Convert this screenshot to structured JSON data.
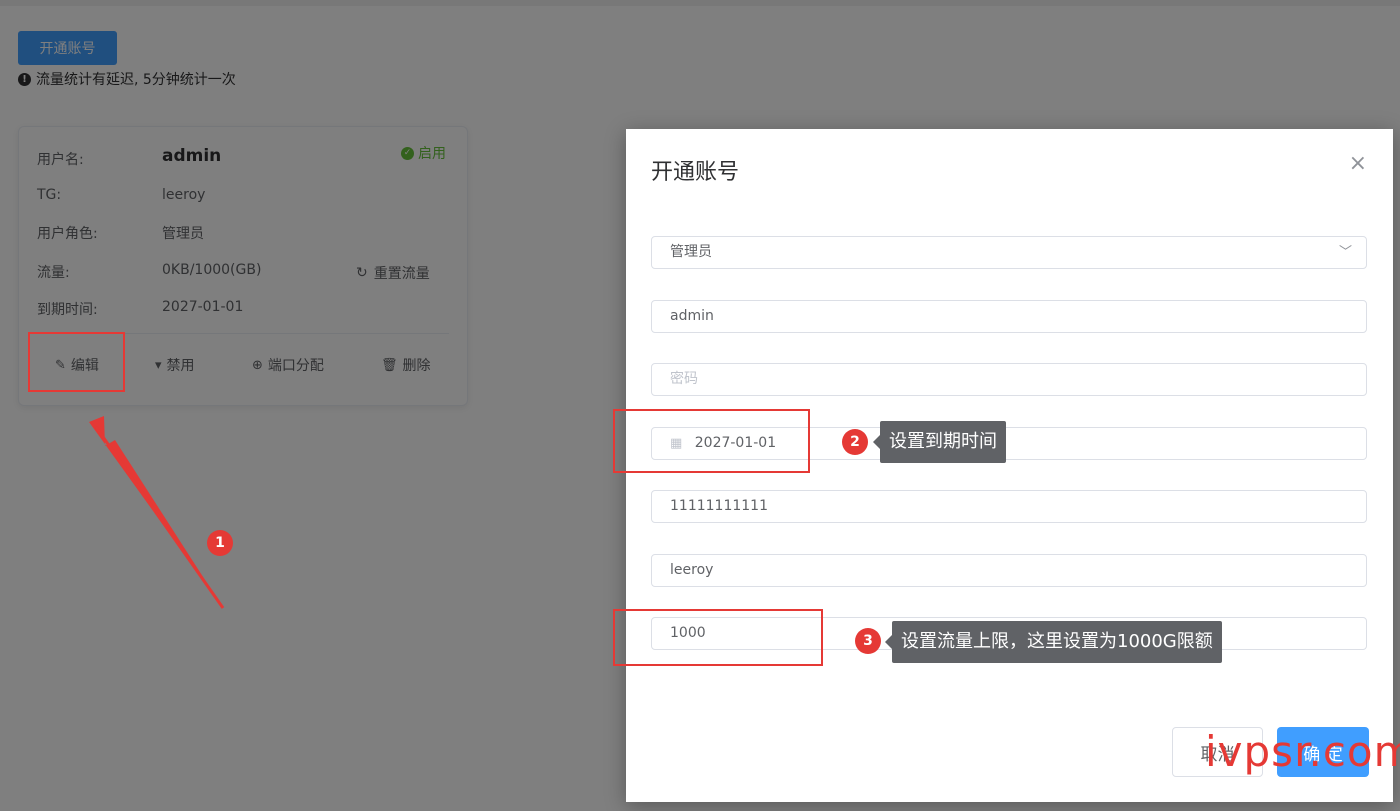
{
  "page": {
    "create_account_btn": "开通账号",
    "notice": "流量统计有延迟, 5分钟统计一次",
    "notice_icon": "!"
  },
  "card": {
    "labels": {
      "username": "用户名:",
      "tg": "TG:",
      "role": "用户角色:",
      "traffic": "流量:",
      "expire": "到期时间:"
    },
    "values": {
      "username": "admin",
      "tg": "leeroy",
      "role": "管理员",
      "traffic": "0KB/1000(GB)",
      "expire": "2027-01-01"
    },
    "status": "启用",
    "reset_traffic": "重置流量",
    "actions": {
      "edit": "编辑",
      "disable": "禁用",
      "port": "端口分配",
      "delete": "删除"
    }
  },
  "modal": {
    "title": "开通账号",
    "close": "×",
    "role_value": "管理员",
    "username_value": "admin",
    "password_placeholder": "密码",
    "expire_value": "2027-01-01",
    "phone_value": "11111111111",
    "tg_value": "leeroy",
    "traffic_value": "1000",
    "cancel": "取消",
    "ok": "确 定"
  },
  "annotations": {
    "badge1": "1",
    "badge2": "2",
    "badge3": "3",
    "tip2": "设置到期时间",
    "tip3": "设置流量上限，这里设置为1000G限额"
  },
  "watermark": "ivpsr.com",
  "colors": {
    "primary": "#409eff",
    "success": "#67c23a",
    "annotation_red": "#e53935",
    "overlay": "rgba(0,0,0,0.5)"
  }
}
